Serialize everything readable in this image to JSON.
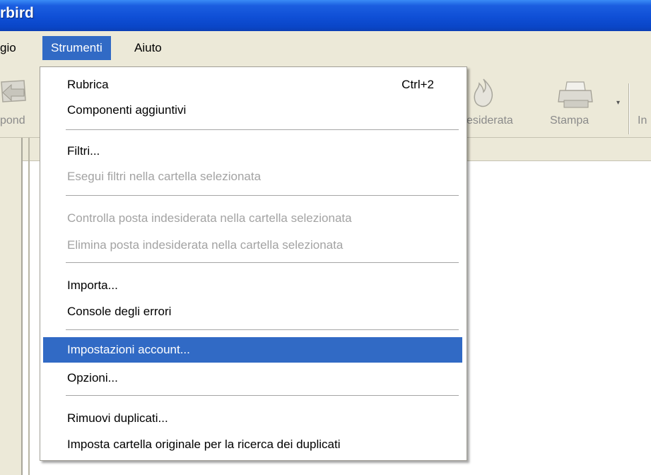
{
  "window": {
    "title_fragment": "rbird"
  },
  "menubar": {
    "items": [
      {
        "label": "gio"
      },
      {
        "label": "Strumenti",
        "active": true
      },
      {
        "label": "Aiuto"
      }
    ]
  },
  "toolbar": {
    "items": [
      {
        "label": "pond",
        "icon": "reply-icon"
      },
      {
        "label": "esiderata",
        "icon": "junk-flame-icon"
      },
      {
        "label": "Stampa",
        "icon": "printer-icon"
      },
      {
        "label": "In",
        "icon": ""
      }
    ]
  },
  "menu": {
    "items": [
      {
        "label": "Rubrica",
        "shortcut": "Ctrl+2",
        "enabled": true
      },
      {
        "label": "Componenti aggiuntivi",
        "enabled": true
      },
      {
        "label": "Filtri...",
        "enabled": true
      },
      {
        "label": "Esegui filtri nella cartella selezionata",
        "enabled": false
      },
      {
        "label": "Controlla posta indesiderata nella cartella selezionata",
        "enabled": false
      },
      {
        "label": "Elimina posta indesiderata nella cartella selezionata",
        "enabled": false
      },
      {
        "label": "Importa...",
        "enabled": true
      },
      {
        "label": "Console degli errori",
        "enabled": true
      },
      {
        "label": "Impostazioni account...",
        "enabled": true,
        "highlighted": true
      },
      {
        "label": "Opzioni...",
        "enabled": true
      },
      {
        "label": "Rimuovi duplicati...",
        "enabled": true
      },
      {
        "label": "Imposta cartella originale per la ricerca dei duplicati",
        "enabled": true
      }
    ]
  },
  "colors": {
    "titlebar": "#0a46c8",
    "menu_highlight": "#316ac5",
    "chrome": "#ece9d8",
    "disabled_text": "#a3a3a3"
  }
}
